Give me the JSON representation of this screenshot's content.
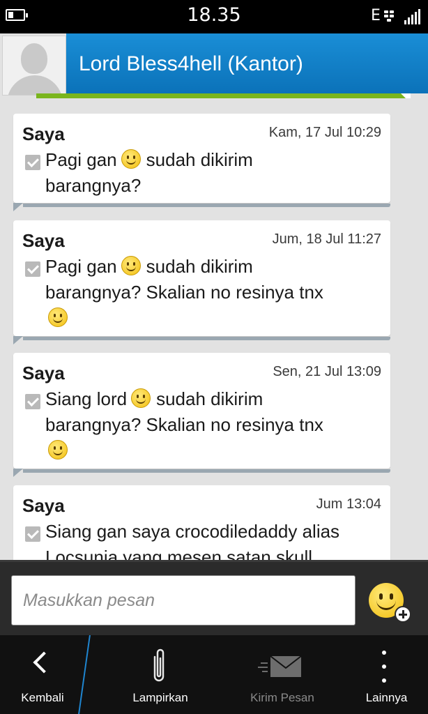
{
  "status_bar": {
    "time": "18.35",
    "network": "E",
    "battery_level": 0.35
  },
  "header": {
    "contact_name": "Lord Bless4hell (Kantor)",
    "accent_color": "#0b72b9",
    "strip_color": "#7ab51d"
  },
  "messages": [
    {
      "sender": "Saya",
      "time": "Kam, 17 Jul 10:29",
      "line1_a": "Pagi gan",
      "line1_b": "sudah dikirim",
      "line2": "barangnya?"
    },
    {
      "sender": "Saya",
      "time": "Jum, 18 Jul 11:27",
      "line1_a": "Pagi gan",
      "line1_b": "sudah dikirim",
      "line2": "barangnya? Skalian no resinya tnx"
    },
    {
      "sender": "Saya",
      "time": "Sen, 21 Jul 13:09",
      "line1_a": "Siang lord",
      "line1_b": "sudah dikirim",
      "line2": "barangnya? Skalian no resinya tnx"
    },
    {
      "sender": "Saya",
      "time": "Jum 13:04",
      "line1_a": "Siang gan saya crocodiledaddy alias",
      "line2": "Locsunja yang mesen satan skull"
    }
  ],
  "compose": {
    "placeholder": "Masukkan pesan",
    "emoji_icon": "smiley-add-icon"
  },
  "actions": {
    "back": "Kembali",
    "attach": "Lampirkan",
    "send": "Kirim Pesan",
    "more": "Lainnya"
  }
}
